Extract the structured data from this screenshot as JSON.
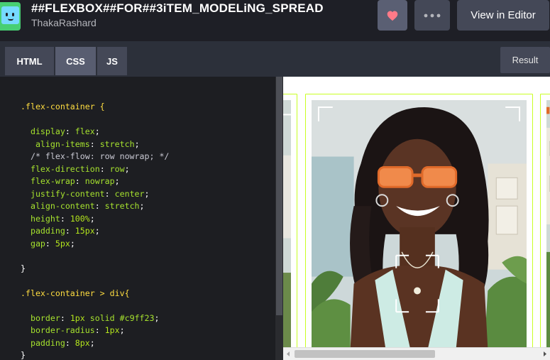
{
  "header": {
    "title": "##FLEXBOX##FOR##3iTEM_MODELiNG_SPREAD",
    "author": "ThakaRashard",
    "view_in_editor": "View in Editor"
  },
  "tabs": [
    {
      "label": "HTML"
    },
    {
      "label": "CSS"
    },
    {
      "label": "JS"
    }
  ],
  "result_label": "Result",
  "code_lines": [
    [
      [
        "sel",
        ".flex-container {"
      ]
    ],
    [],
    [
      [
        "prop",
        "  display"
      ],
      [
        "pun",
        ": "
      ],
      [
        "val",
        "flex"
      ],
      [
        "pun",
        ";"
      ]
    ],
    [
      [
        "prop",
        "   align-items"
      ],
      [
        "pun",
        ": "
      ],
      [
        "val",
        "stretch"
      ],
      [
        "pun",
        ";"
      ]
    ],
    [
      [
        "cmt",
        "  /* flex-flow: row nowrap; */"
      ]
    ],
    [
      [
        "prop",
        "  flex-direction"
      ],
      [
        "pun",
        ": "
      ],
      [
        "val",
        "row"
      ],
      [
        "pun",
        ";"
      ]
    ],
    [
      [
        "prop",
        "  flex-wrap"
      ],
      [
        "pun",
        ": "
      ],
      [
        "val",
        "nowrap"
      ],
      [
        "pun",
        ";"
      ]
    ],
    [
      [
        "prop",
        "  justify-content"
      ],
      [
        "pun",
        ": "
      ],
      [
        "val",
        "center"
      ],
      [
        "pun",
        ";"
      ]
    ],
    [
      [
        "prop",
        "  align-content"
      ],
      [
        "pun",
        ": "
      ],
      [
        "val",
        "stretch"
      ],
      [
        "pun",
        ";"
      ]
    ],
    [
      [
        "prop",
        "  height"
      ],
      [
        "pun",
        ": "
      ],
      [
        "num",
        "100%"
      ],
      [
        "pun",
        ";"
      ]
    ],
    [
      [
        "prop",
        "  padding"
      ],
      [
        "pun",
        ": "
      ],
      [
        "num",
        "15px"
      ],
      [
        "pun",
        ";"
      ]
    ],
    [
      [
        "prop",
        "  gap"
      ],
      [
        "pun",
        ": "
      ],
      [
        "num",
        "5px"
      ],
      [
        "pun",
        ";"
      ]
    ],
    [],
    [
      [
        "pun",
        "}"
      ]
    ],
    [],
    [
      [
        "sel",
        ".flex-container > div{"
      ]
    ],
    [],
    [
      [
        "prop",
        "  border"
      ],
      [
        "pun",
        ": "
      ],
      [
        "num",
        "1px"
      ],
      [
        "val",
        " solid "
      ],
      [
        "val",
        "#c9ff23"
      ],
      [
        "pun",
        ";"
      ]
    ],
    [
      [
        "prop",
        "  border-radius"
      ],
      [
        "pun",
        ": "
      ],
      [
        "num",
        "1px"
      ],
      [
        "pun",
        ";"
      ]
    ],
    [
      [
        "prop",
        "  padding"
      ],
      [
        "pun",
        ": "
      ],
      [
        "num",
        "8px"
      ],
      [
        "pun",
        ";"
      ]
    ],
    [
      [
        "pun",
        "}"
      ]
    ]
  ],
  "icons": {
    "heart": "heart-icon",
    "more": "more-icon",
    "logo": "codepen-logo"
  },
  "colors": {
    "accent_border": "#c9ff23",
    "header_bg": "#1e1f26",
    "editor_bg": "#1d1e22"
  }
}
